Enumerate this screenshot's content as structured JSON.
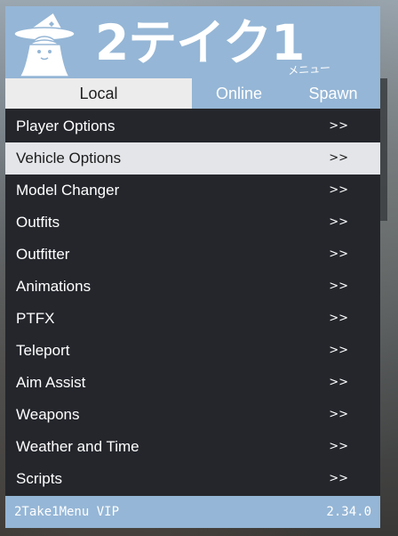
{
  "header": {
    "brand": "2テイク1",
    "brand_sub": "メニュー"
  },
  "tabs": [
    {
      "label": "Local",
      "active": true
    },
    {
      "label": "Online",
      "active": false
    },
    {
      "label": "Spawn",
      "active": false
    }
  ],
  "items": [
    {
      "label": "Player Options",
      "arrow": ">>",
      "selected": false
    },
    {
      "label": "Vehicle Options",
      "arrow": ">>",
      "selected": true
    },
    {
      "label": "Model Changer",
      "arrow": ">>",
      "selected": false
    },
    {
      "label": "Outfits",
      "arrow": ">>",
      "selected": false
    },
    {
      "label": "Outfitter",
      "arrow": ">>",
      "selected": false
    },
    {
      "label": "Animations",
      "arrow": ">>",
      "selected": false
    },
    {
      "label": "PTFX",
      "arrow": ">>",
      "selected": false
    },
    {
      "label": "Teleport",
      "arrow": ">>",
      "selected": false
    },
    {
      "label": "Aim Assist",
      "arrow": ">>",
      "selected": false
    },
    {
      "label": "Weapons",
      "arrow": ">>",
      "selected": false
    },
    {
      "label": "Weather and Time",
      "arrow": ">>",
      "selected": false
    },
    {
      "label": "Scripts",
      "arrow": ">>",
      "selected": false
    }
  ],
  "footer": {
    "name": "2Take1Menu VIP",
    "version": "2.34.0"
  },
  "colors": {
    "accent": "#95b6d6",
    "selected_bg": "#e3e5e8",
    "item_bg": "#24262c"
  },
  "icons": {
    "mascot": "witch-girl-logo"
  }
}
